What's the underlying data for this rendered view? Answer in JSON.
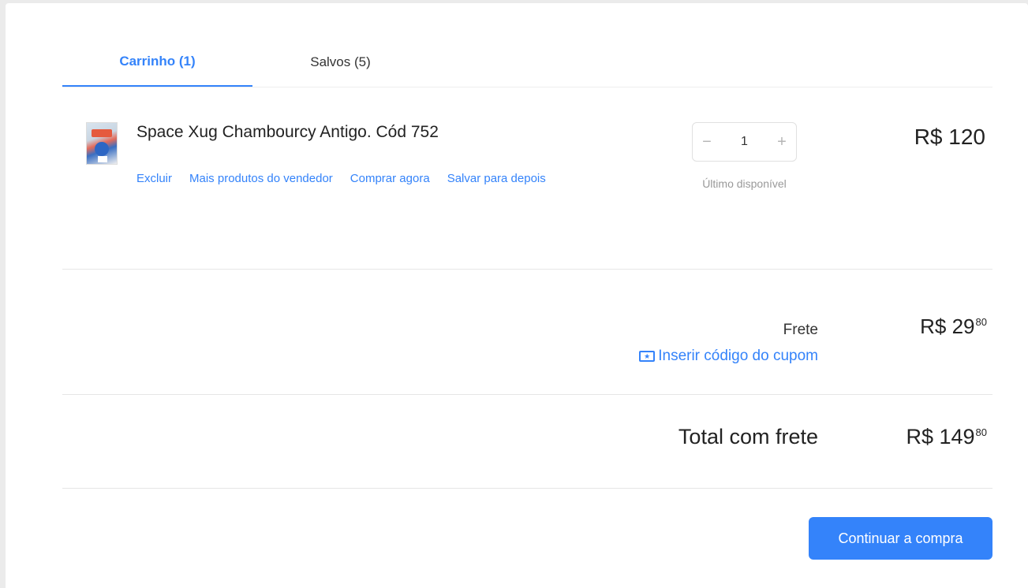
{
  "tabs": [
    {
      "label": "Carrinho (1)",
      "active": true
    },
    {
      "label": "Salvos (5)",
      "active": false
    }
  ],
  "item": {
    "title": "Space Xug Chambourcy Antigo. Cód 752",
    "actions": [
      "Excluir",
      "Mais produtos do vendedor",
      "Comprar agora",
      "Salvar para depois"
    ],
    "quantity": "1",
    "stock_note": "Último disponível",
    "price": "R$ 120"
  },
  "shipping": {
    "label": "Frete",
    "price_main": "R$ 29",
    "price_cents": "80",
    "coupon_link": "Inserir código do cupom"
  },
  "total": {
    "label": "Total com frete",
    "price_main": "R$ 149",
    "price_cents": "80"
  },
  "continue_label": "Continuar a compra",
  "colors": {
    "accent": "#3483fa",
    "background": "#ebebeb",
    "card": "#ffffff"
  }
}
